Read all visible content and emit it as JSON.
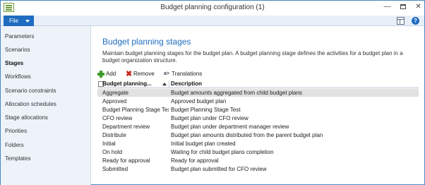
{
  "window": {
    "title": "Budget planning configuration (1)"
  },
  "ribbon": {
    "file_label": "File"
  },
  "nav": {
    "items": [
      {
        "label": "Parameters"
      },
      {
        "label": "Scenarios"
      },
      {
        "label": "Stages"
      },
      {
        "label": "Workflows"
      },
      {
        "label": "Scenario constraints"
      },
      {
        "label": "Allocation schedules"
      },
      {
        "label": "Stage allocations"
      },
      {
        "label": "Priorities"
      },
      {
        "label": "Folders"
      },
      {
        "label": "Templates"
      }
    ],
    "active_index": 2
  },
  "main": {
    "title": "Budget planning stages",
    "description": "Maintain budget planning stages for the budget plan. A budget planning stage defines the activities for a budget plan in a budget organization structure.",
    "toolbar": {
      "add_label": "Add",
      "remove_label": "Remove",
      "translations_label": "Translations"
    },
    "grid": {
      "columns": [
        "Budget planning...",
        "Description"
      ],
      "rows": [
        {
          "name": "Aggregate",
          "description": "Budget amounts aggregated from child budget plans"
        },
        {
          "name": "Approved",
          "description": "Approved budget plan"
        },
        {
          "name": "Budget Planning Stage Test",
          "description": "Budget Planning Stage Test"
        },
        {
          "name": "CFO review",
          "description": "Budget plan under CFO review"
        },
        {
          "name": "Department review",
          "description": "Budget plan under department manager review"
        },
        {
          "name": "Distribute",
          "description": "Budget plan amounts distributed from the parent budget plan"
        },
        {
          "name": "Initial",
          "description": "Initial budget plan created"
        },
        {
          "name": "On hold",
          "description": "Waiting for child budget plans completion"
        },
        {
          "name": "Ready for approval",
          "description": "Ready for approval"
        },
        {
          "name": "Submitted",
          "description": "Budget plan submitted for CFO review"
        }
      ],
      "selected_index": 0
    }
  },
  "colors": {
    "accent": "#1f6cc0",
    "nav_background": "#eef3fa",
    "selected_row": "#e1e1e1"
  }
}
